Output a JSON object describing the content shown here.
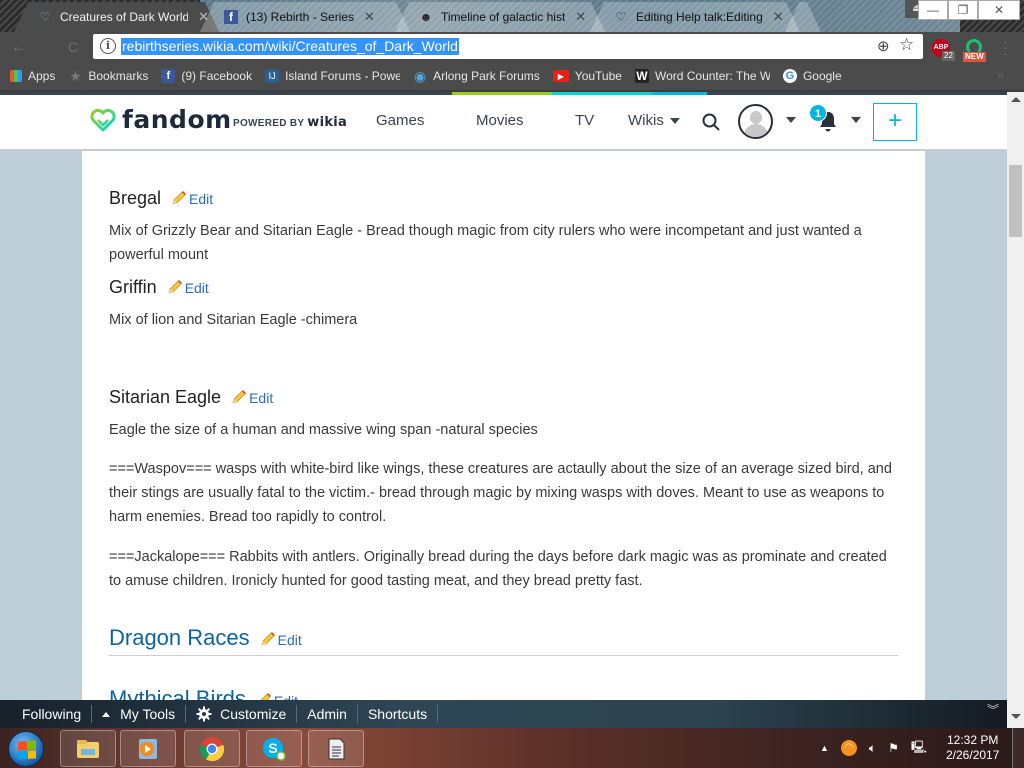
{
  "browser": {
    "tabs": [
      {
        "title": "Creatures of Dark World",
        "icon": "fandom-heart-icon",
        "active": true
      },
      {
        "title": "(13) Rebirth - Series",
        "icon": "facebook-icon",
        "active": false
      },
      {
        "title": "Timeline of galactic hist",
        "icon": "skull-icon",
        "active": false
      },
      {
        "title": "Editing Help talk:Editing",
        "icon": "fandom-heart-icon",
        "active": false
      }
    ],
    "window_controls": {
      "minimize": "—",
      "restore": "❐",
      "close": "✕"
    },
    "nav": {
      "back": "←",
      "reload": "C"
    },
    "url": "rebirthseries.wikia.com/wiki/Creatures_of_Dark_World",
    "extensions": {
      "abp_label": "ABP",
      "abp_count": "22",
      "ext_badge": "NEW"
    },
    "bookmarks": [
      {
        "label": "Apps",
        "icon": "apps-grid-icon"
      },
      {
        "label": "Bookmarks",
        "icon": "star-icon"
      },
      {
        "label": "(9) Facebook",
        "icon": "facebook-icon"
      },
      {
        "label": "Island Forums - Powe",
        "icon": "island-forums-icon"
      },
      {
        "label": "Arlong Park Forums",
        "icon": "arlong-park-icon"
      },
      {
        "label": "YouTube",
        "icon": "youtube-icon"
      },
      {
        "label": "Word Counter: The W",
        "icon": "word-counter-icon"
      },
      {
        "label": "Google",
        "icon": "google-icon"
      }
    ],
    "bookmarks_more": "»"
  },
  "fandom": {
    "logo_text": "fandom",
    "powered_by": "POWERED BY",
    "powered_brand": "wikia",
    "nav": [
      "Games",
      "Movies",
      "TV",
      "Wikis"
    ],
    "notification_count": "1",
    "add_label": "+",
    "strip_colors": [
      "#3a4351",
      "#94d11f",
      "#00d6d6",
      "#00b7e0",
      "#3a4351"
    ]
  },
  "article": {
    "edit_label": "Edit",
    "sections": [
      {
        "title": "Bregal",
        "level": 3,
        "body": "Mix of Grizzly Bear and Sitarian Eagle - Bread though magic from city rulers who were incompetant and just wanted a powerful mount"
      },
      {
        "title": "Griffin",
        "level": 3,
        "body": "Mix of lion and Sitarian Eagle -chimera"
      },
      {
        "title": "Sitarian Eagle",
        "level": 3,
        "body": "Eagle the size of a human and massive wing span -natural species"
      }
    ],
    "paragraphs": [
      "===Waspov=== wasps with white-bird like wings, these creatures are actaully about the size of an average sized bird, and their stings are usually fatal to the victim.- bread through magic by mixing wasps with doves. Meant to use as weapons to harm enemies. Bread too rapidly to control.",
      "===Jackalope=== Rabbits with antlers. Originally bread during the days before dark magic was as prominate and created to amuse children. Ironicly hunted for good tasting meat, and they bread pretty fast."
    ],
    "h2_sections": [
      "Dragon Races",
      "Mythical Birds"
    ]
  },
  "wiki_toolbar": {
    "items": [
      "Following",
      "My Tools",
      "Customize",
      "Admin",
      "Shortcuts"
    ],
    "collapse": "︾"
  },
  "taskbar": {
    "apps": [
      "windows-explorer",
      "media-player",
      "chrome",
      "skype",
      "document-app"
    ],
    "time": "12:32 PM",
    "date": "2/26/2017"
  }
}
